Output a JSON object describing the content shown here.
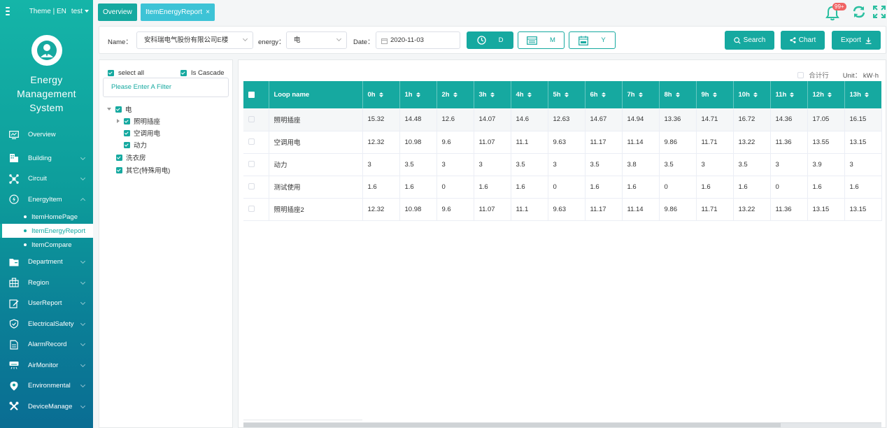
{
  "sidebar": {
    "theme_lang": "Theme | EN",
    "user": "test",
    "system_title_lines": [
      "Energy",
      "Management",
      "System"
    ],
    "menu": [
      {
        "key": "overview",
        "label": "Overview",
        "icon": "monitor-icon"
      },
      {
        "key": "building",
        "label": "Building",
        "icon": "building-icon"
      },
      {
        "key": "circuit",
        "label": "Circuit",
        "icon": "circuit-icon"
      },
      {
        "key": "energyitem",
        "label": "EnergyItem",
        "icon": "power-icon"
      },
      {
        "key": "department",
        "label": "Department",
        "icon": "folder-icon"
      },
      {
        "key": "region",
        "label": "Region",
        "icon": "grid-icon"
      },
      {
        "key": "userreport",
        "label": "UserReport",
        "icon": "edit-icon"
      },
      {
        "key": "electricalsafety",
        "label": "ElectricalSafety",
        "icon": "shield-icon"
      },
      {
        "key": "alarmrecord",
        "label": "AlarmRecord",
        "icon": "document-icon"
      },
      {
        "key": "airmonitor",
        "label": "AirMonitor",
        "icon": "air-conditioner-icon"
      },
      {
        "key": "environmental",
        "label": "Environmental",
        "icon": "location-pin-icon"
      },
      {
        "key": "devicemanage",
        "label": "DeviceManage",
        "icon": "tools-icon"
      }
    ],
    "energyitem_sub": [
      "ItemHomePage",
      "ItemEnergyReport",
      "ItemCompare"
    ]
  },
  "tabs": {
    "overview": "Overview",
    "active": "ItemEnergyReport",
    "close": "×"
  },
  "notifications": {
    "badge": "99+"
  },
  "filter": {
    "name_label": "Name：",
    "name_value": "安科瑞电气股份有限公司E楼",
    "energy_label": "energy：",
    "energy_value": "电",
    "date_label": "Date：",
    "date_value": "2020-11-03",
    "period_d": "D",
    "period_m": "M",
    "period_y": "Y",
    "search": "Search",
    "chart": "Chart",
    "export": "Export"
  },
  "tree": {
    "select_all": "select all",
    "is_cascade": "Is Cascade",
    "filter_placeholder": "Please Enter A Filter",
    "nodes": {
      "root": "电",
      "lighting": "照明插座",
      "aircon": "空调用电",
      "power": "动力",
      "laundry": "洗衣房",
      "other": "其它(特殊用电)"
    }
  },
  "table": {
    "total_label": "合计行",
    "unit": "Unit： kW·h",
    "loop_name_header": "Loop name",
    "hour_headers": [
      "0h",
      "1h",
      "2h",
      "3h",
      "4h",
      "5h",
      "6h",
      "7h",
      "8h",
      "9h",
      "10h",
      "11h",
      "12h",
      "13h"
    ],
    "rows": [
      {
        "name": "照明插座",
        "values": [
          "15.32",
          "14.48",
          "12.6",
          "14.07",
          "14.6",
          "12.63",
          "14.67",
          "14.94",
          "13.36",
          "14.71",
          "16.72",
          "14.36",
          "17.05",
          "16.15"
        ]
      },
      {
        "name": "空调用电",
        "values": [
          "12.32",
          "10.98",
          "9.6",
          "11.07",
          "11.1",
          "9.63",
          "11.17",
          "11.14",
          "9.86",
          "11.71",
          "13.22",
          "11.36",
          "13.55",
          "13.15"
        ]
      },
      {
        "name": "动力",
        "values": [
          "3",
          "3.5",
          "3",
          "3",
          "3.5",
          "3",
          "3.5",
          "3.8",
          "3.5",
          "3",
          "3.5",
          "3",
          "3.9",
          "3"
        ]
      },
      {
        "name": "测试使用",
        "values": [
          "1.6",
          "1.6",
          "0",
          "1.6",
          "1.6",
          "0",
          "1.6",
          "1.6",
          "0",
          "1.6",
          "1.6",
          "0",
          "1.6",
          "1.6"
        ]
      },
      {
        "name": "照明插座2",
        "values": [
          "12.32",
          "10.98",
          "9.6",
          "11.07",
          "11.1",
          "9.63",
          "11.17",
          "11.14",
          "9.86",
          "11.71",
          "13.22",
          "11.36",
          "13.15",
          "13.15"
        ]
      }
    ]
  },
  "colors": {
    "accent": "#16a9a0",
    "tab_active": "#3dc3d6",
    "badge": "#f06464"
  }
}
